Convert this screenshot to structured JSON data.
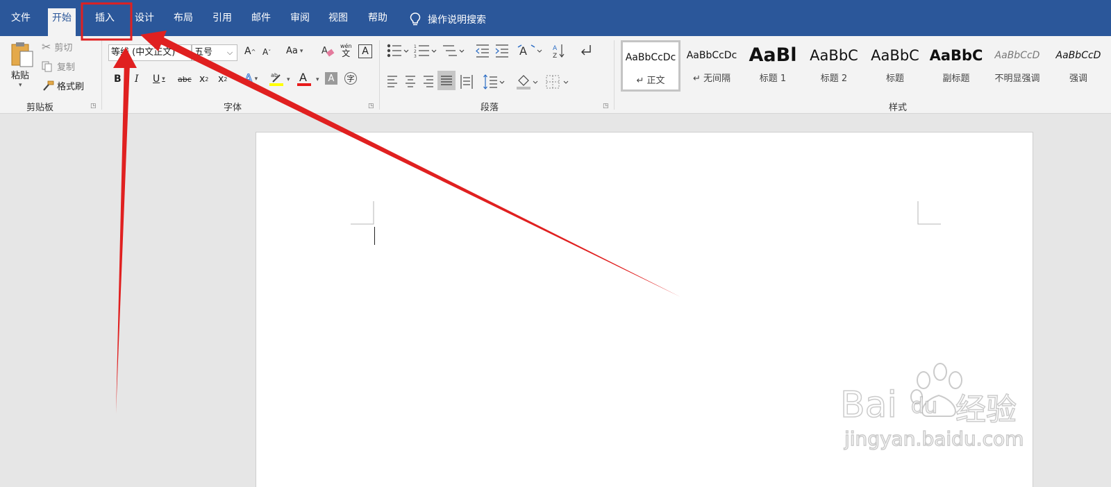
{
  "tabs": [
    "文件",
    "开始",
    "插入",
    "设计",
    "布局",
    "引用",
    "邮件",
    "审阅",
    "视图",
    "帮助"
  ],
  "active_tab": "开始",
  "highlighted_tab": "插入",
  "tell_me": "操作说明搜索",
  "clipboard": {
    "paste": "粘贴",
    "cut": "剪切",
    "copy": "复制",
    "format_painter": "格式刷",
    "label": "剪贴板"
  },
  "font": {
    "font_name": "等线 (中文正文)",
    "font_size": "五号",
    "change_case": "Aa",
    "phonetic": "文",
    "label": "字体"
  },
  "paragraph": {
    "label": "段落"
  },
  "styles": {
    "label": "样式",
    "items": [
      {
        "preview": "AaBbCcDc",
        "name": "↵ 正文"
      },
      {
        "preview": "AaBbCcDc",
        "name": "↵ 无间隔"
      },
      {
        "preview": "AaBl",
        "name": "标题 1"
      },
      {
        "preview": "AaBbC",
        "name": "标题 2"
      },
      {
        "preview": "AaBbC",
        "name": "标题"
      },
      {
        "preview": "AaBbC",
        "name": "副标题"
      },
      {
        "preview": "AaBbCcD",
        "name": "不明显强调"
      },
      {
        "preview": "AaBbCcD",
        "name": "强调"
      }
    ]
  },
  "watermark": {
    "brand_a": "Bai",
    "brand_b": "du",
    "brand_c": "经验",
    "url": "jingyan.baidu.com"
  },
  "colors": {
    "title_bar": "#2b579a",
    "ribbon": "#f3f3f3",
    "annotation": "#e02020",
    "canvas": "#e6e6e6"
  }
}
